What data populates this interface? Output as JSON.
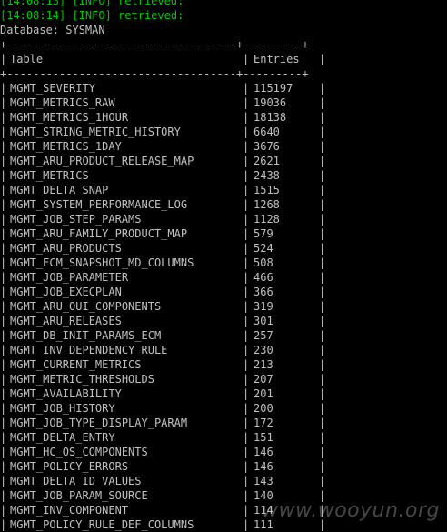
{
  "log_lines": [
    "[14:08:13] [INFO] retrieved:",
    "[14:08:14] [INFO] retrieved:"
  ],
  "database_line": "Database: SYSMAN",
  "table": {
    "border": "+-----------------------------------+---------+",
    "header_table": "Table",
    "header_entries": "Entries",
    "rows": [
      {
        "table": "MGMT_SEVERITY",
        "entries": "115197"
      },
      {
        "table": "MGMT_METRICS_RAW",
        "entries": "19036"
      },
      {
        "table": "MGMT_METRICS_1HOUR",
        "entries": "18138"
      },
      {
        "table": "MGMT_STRING_METRIC_HISTORY",
        "entries": "6640"
      },
      {
        "table": "MGMT_METRICS_1DAY",
        "entries": "3676"
      },
      {
        "table": "MGMT_ARU_PRODUCT_RELEASE_MAP",
        "entries": "2621"
      },
      {
        "table": "MGMT_METRICS",
        "entries": "2438"
      },
      {
        "table": "MGMT_DELTA_SNAP",
        "entries": "1515"
      },
      {
        "table": "MGMT_SYSTEM_PERFORMANCE_LOG",
        "entries": "1268"
      },
      {
        "table": "MGMT_JOB_STEP_PARAMS",
        "entries": "1128"
      },
      {
        "table": "MGMT_ARU_FAMILY_PRODUCT_MAP",
        "entries": "579"
      },
      {
        "table": "MGMT_ARU_PRODUCTS",
        "entries": "524"
      },
      {
        "table": "MGMT_ECM_SNAPSHOT_MD_COLUMNS",
        "entries": "508"
      },
      {
        "table": "MGMT_JOB_PARAMETER",
        "entries": "466"
      },
      {
        "table": "MGMT_JOB_EXECPLAN",
        "entries": "366"
      },
      {
        "table": "MGMT_ARU_OUI_COMPONENTS",
        "entries": "319"
      },
      {
        "table": "MGMT_ARU_RELEASES",
        "entries": "301"
      },
      {
        "table": "MGMT_DB_INIT_PARAMS_ECM",
        "entries": "257"
      },
      {
        "table": "MGMT_INV_DEPENDENCY_RULE",
        "entries": "230"
      },
      {
        "table": "MGMT_CURRENT_METRICS",
        "entries": "213"
      },
      {
        "table": "MGMT_METRIC_THRESHOLDS",
        "entries": "207"
      },
      {
        "table": "MGMT_AVAILABILITY",
        "entries": "201"
      },
      {
        "table": "MGMT_JOB_HISTORY",
        "entries": "200"
      },
      {
        "table": "MGMT_JOB_TYPE_DISPLAY_PARAM",
        "entries": "172"
      },
      {
        "table": "MGMT_DELTA_ENTRY",
        "entries": "151"
      },
      {
        "table": "MGMT_HC_OS_COMPONENTS",
        "entries": "146"
      },
      {
        "table": "MGMT_POLICY_ERRORS",
        "entries": "146"
      },
      {
        "table": "MGMT_DELTA_ID_VALUES",
        "entries": "143"
      },
      {
        "table": "MGMT_JOB_PARAM_SOURCE",
        "entries": "140"
      },
      {
        "table": "MGMT_INV_COMPONENT",
        "entries": "114"
      },
      {
        "table": "MGMT_POLICY_RULE_DEF_COLUMNS",
        "entries": "111"
      }
    ]
  },
  "watermark": "www.wooyun.org",
  "colors": {
    "background": "#000000",
    "text": "#c0c0c0",
    "log": "#00c800"
  }
}
